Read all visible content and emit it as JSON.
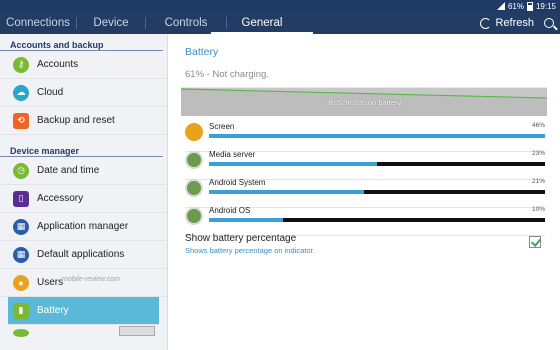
{
  "status_bar": {
    "battery": "61%",
    "time": "19:15"
  },
  "tabs": [
    {
      "label": "Connections"
    },
    {
      "label": "Device"
    },
    {
      "label": "Controls"
    },
    {
      "label": "General",
      "selected": true
    }
  ],
  "actions": {
    "refresh_label": "Refresh",
    "refresh_icon": "refresh-icon",
    "search_icon": "search-icon"
  },
  "sidebar": {
    "sections": [
      {
        "title": "Accounts and backup",
        "items": [
          {
            "label": "Accounts",
            "icon": "key-icon",
            "color": "#7ab934"
          },
          {
            "label": "Cloud",
            "icon": "cloud-icon",
            "color": "#2aa6c9"
          },
          {
            "label": "Backup and reset",
            "icon": "backup-icon",
            "color": "#f06322"
          }
        ]
      },
      {
        "title": "Device manager",
        "items": [
          {
            "label": "Date and time",
            "icon": "clock-icon",
            "color": "#7ab934"
          },
          {
            "label": "Accessory",
            "icon": "accessory-icon",
            "color": "#5b2c91"
          },
          {
            "label": "Application manager",
            "icon": "apps-icon",
            "color": "#2a5ca8"
          },
          {
            "label": "Default applications",
            "icon": "default-apps-icon",
            "color": "#2a5ca8"
          },
          {
            "label": "Users",
            "icon": "users-icon",
            "color": "#e8a21c"
          },
          {
            "label": "Battery",
            "icon": "battery-icon",
            "color": "#7ab934",
            "active": true
          }
        ]
      }
    ],
    "watermark": "mobile-review.com"
  },
  "main": {
    "title": "Battery",
    "status": "61% - Not charging.",
    "graph_label": "3h 52m 10s on battery",
    "usage": [
      {
        "name": "Screen",
        "percent": "46%",
        "fraction": 1.0,
        "icon": "screen-sun-icon"
      },
      {
        "name": "Media server",
        "percent": "23%",
        "fraction": 0.5,
        "icon": "android-icon"
      },
      {
        "name": "Android System",
        "percent": "21%",
        "fraction": 0.46,
        "icon": "android-icon"
      },
      {
        "name": "Android OS",
        "percent": "10%",
        "fraction": 0.22,
        "icon": "android-icon"
      }
    ],
    "show_percentage": {
      "title": "Show battery percentage",
      "subtitle": "Shows battery percentage on indicator.",
      "checked": true
    }
  }
}
